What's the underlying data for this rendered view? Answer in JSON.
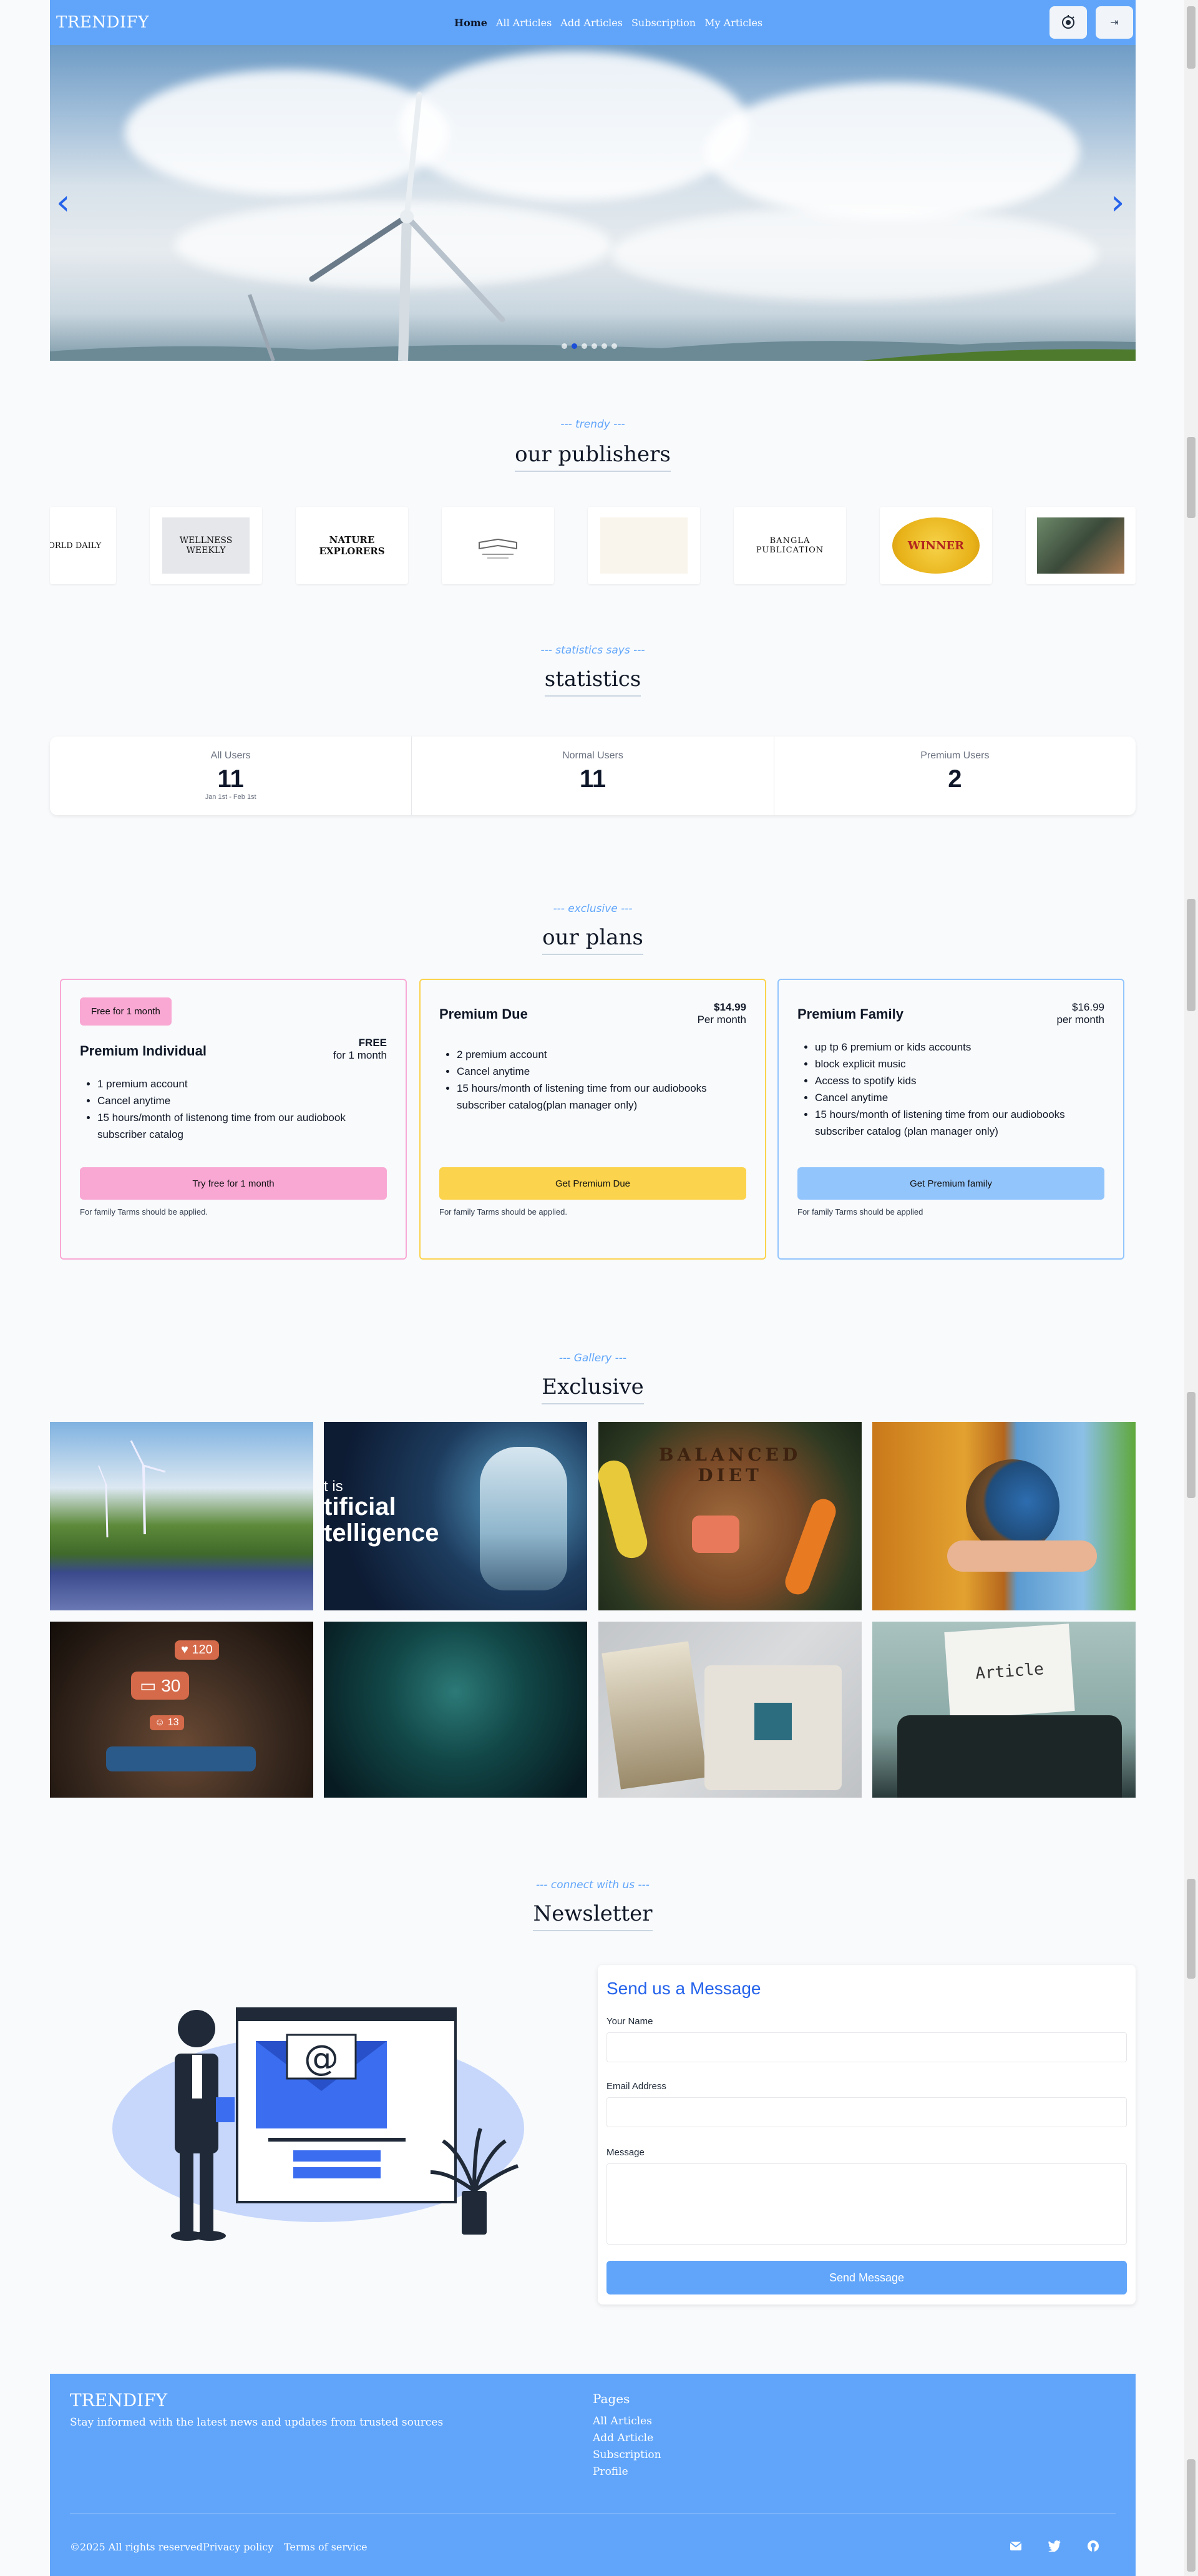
{
  "nav": {
    "brand": "TRENDIFY",
    "links": [
      "Home",
      "All Articles",
      "Add Articles",
      "Subscription",
      "My Articles"
    ],
    "theme_icon": "theme-toggle-icon",
    "logout_icon": "logout-icon",
    "logout_text": "⇥"
  },
  "hero": {
    "prev_icon": "chevron-left-icon",
    "next_icon": "chevron-right-icon",
    "prev": "‹",
    "next": "›",
    "slides": 6,
    "active_slide": 2
  },
  "publishers": {
    "sub": "--- trendy ---",
    "title": "our publishers",
    "logos": [
      "WORLD DAILY",
      "WELLNESS WEEKLY",
      "NATURE EXPLORERS",
      "",
      "",
      "BANGLA PUBLICATION",
      "WINNER",
      ""
    ]
  },
  "stats": {
    "sub": "--- statistics says ---",
    "title": "statistics",
    "items": [
      {
        "label": "All Users",
        "value": "11",
        "sub": "Jan 1st - Feb 1st"
      },
      {
        "label": "Normal Users",
        "value": "11",
        "sub": ""
      },
      {
        "label": "Premium Users",
        "value": "2",
        "sub": ""
      }
    ]
  },
  "plans": {
    "sub": "--- exclusive ---",
    "title": "our plans",
    "items": [
      {
        "badge": "Free for 1 month",
        "name": "Premium Individual",
        "price": "FREE",
        "period": "for 1 month",
        "features": [
          "1 premium account",
          "Cancel anytime",
          "15 hours/month of listenong time from our audiobook subscriber catalog"
        ],
        "button": "Try free for 1 month",
        "note": "For family Tarms should be applied.",
        "color": "#f9a8d4"
      },
      {
        "badge": "",
        "name": "Premium Due",
        "price": "$14.99",
        "period": "Per month",
        "features": [
          "2 premium account",
          "Cancel anytime",
          "15 hours/month of listening time from our audiobooks subscriber catalog(plan manager only)"
        ],
        "button": "Get Premium Due",
        "note": "For family Tarms should be applied.",
        "color": "#fcd34d"
      },
      {
        "badge": "",
        "name": "Premium Family",
        "price": "$16.99",
        "period": "per month",
        "features": [
          "up tp 6 premium or kids accounts",
          "block explicit music",
          "Access to spotify kids",
          "Cancel anytime",
          "15 hours/month of listening time from our audiobooks subscriber catalog (plan manager only)"
        ],
        "button": "Get Premium family",
        "note": "For family Tarms should be applied",
        "color": "#93c5fd"
      }
    ]
  },
  "gallery": {
    "sub": "--- Gallery ---",
    "title": "Exclusive",
    "ai_text_1": "t is",
    "ai_text_2": "tificial",
    "ai_text_3": "telligence",
    "diet_text": "BALANCED DIET",
    "likes": "120",
    "comments": "30",
    "follows": "13",
    "paper_text": "Article"
  },
  "newsletter": {
    "sub": "--- connect with us ---",
    "title": "Newsletter",
    "form_title": "Send us a Message",
    "name_label": "Your Name",
    "email_label": "Email Address",
    "message_label": "Message",
    "button": "Send Message",
    "at_symbol": "@"
  },
  "footer": {
    "title": "TRENDIFY",
    "tagline": "Stay informed with the latest news and updates from trusted sources",
    "pages_heading": "Pages",
    "pages": [
      "All Articles",
      "Add Article",
      "Subscription",
      "Profile"
    ],
    "copyright": "©2025 All rights reserved",
    "privacy": "Privacy policy",
    "terms": "Terms of service",
    "icons": [
      "mail-icon",
      "twitter-icon",
      "github-icon"
    ]
  }
}
